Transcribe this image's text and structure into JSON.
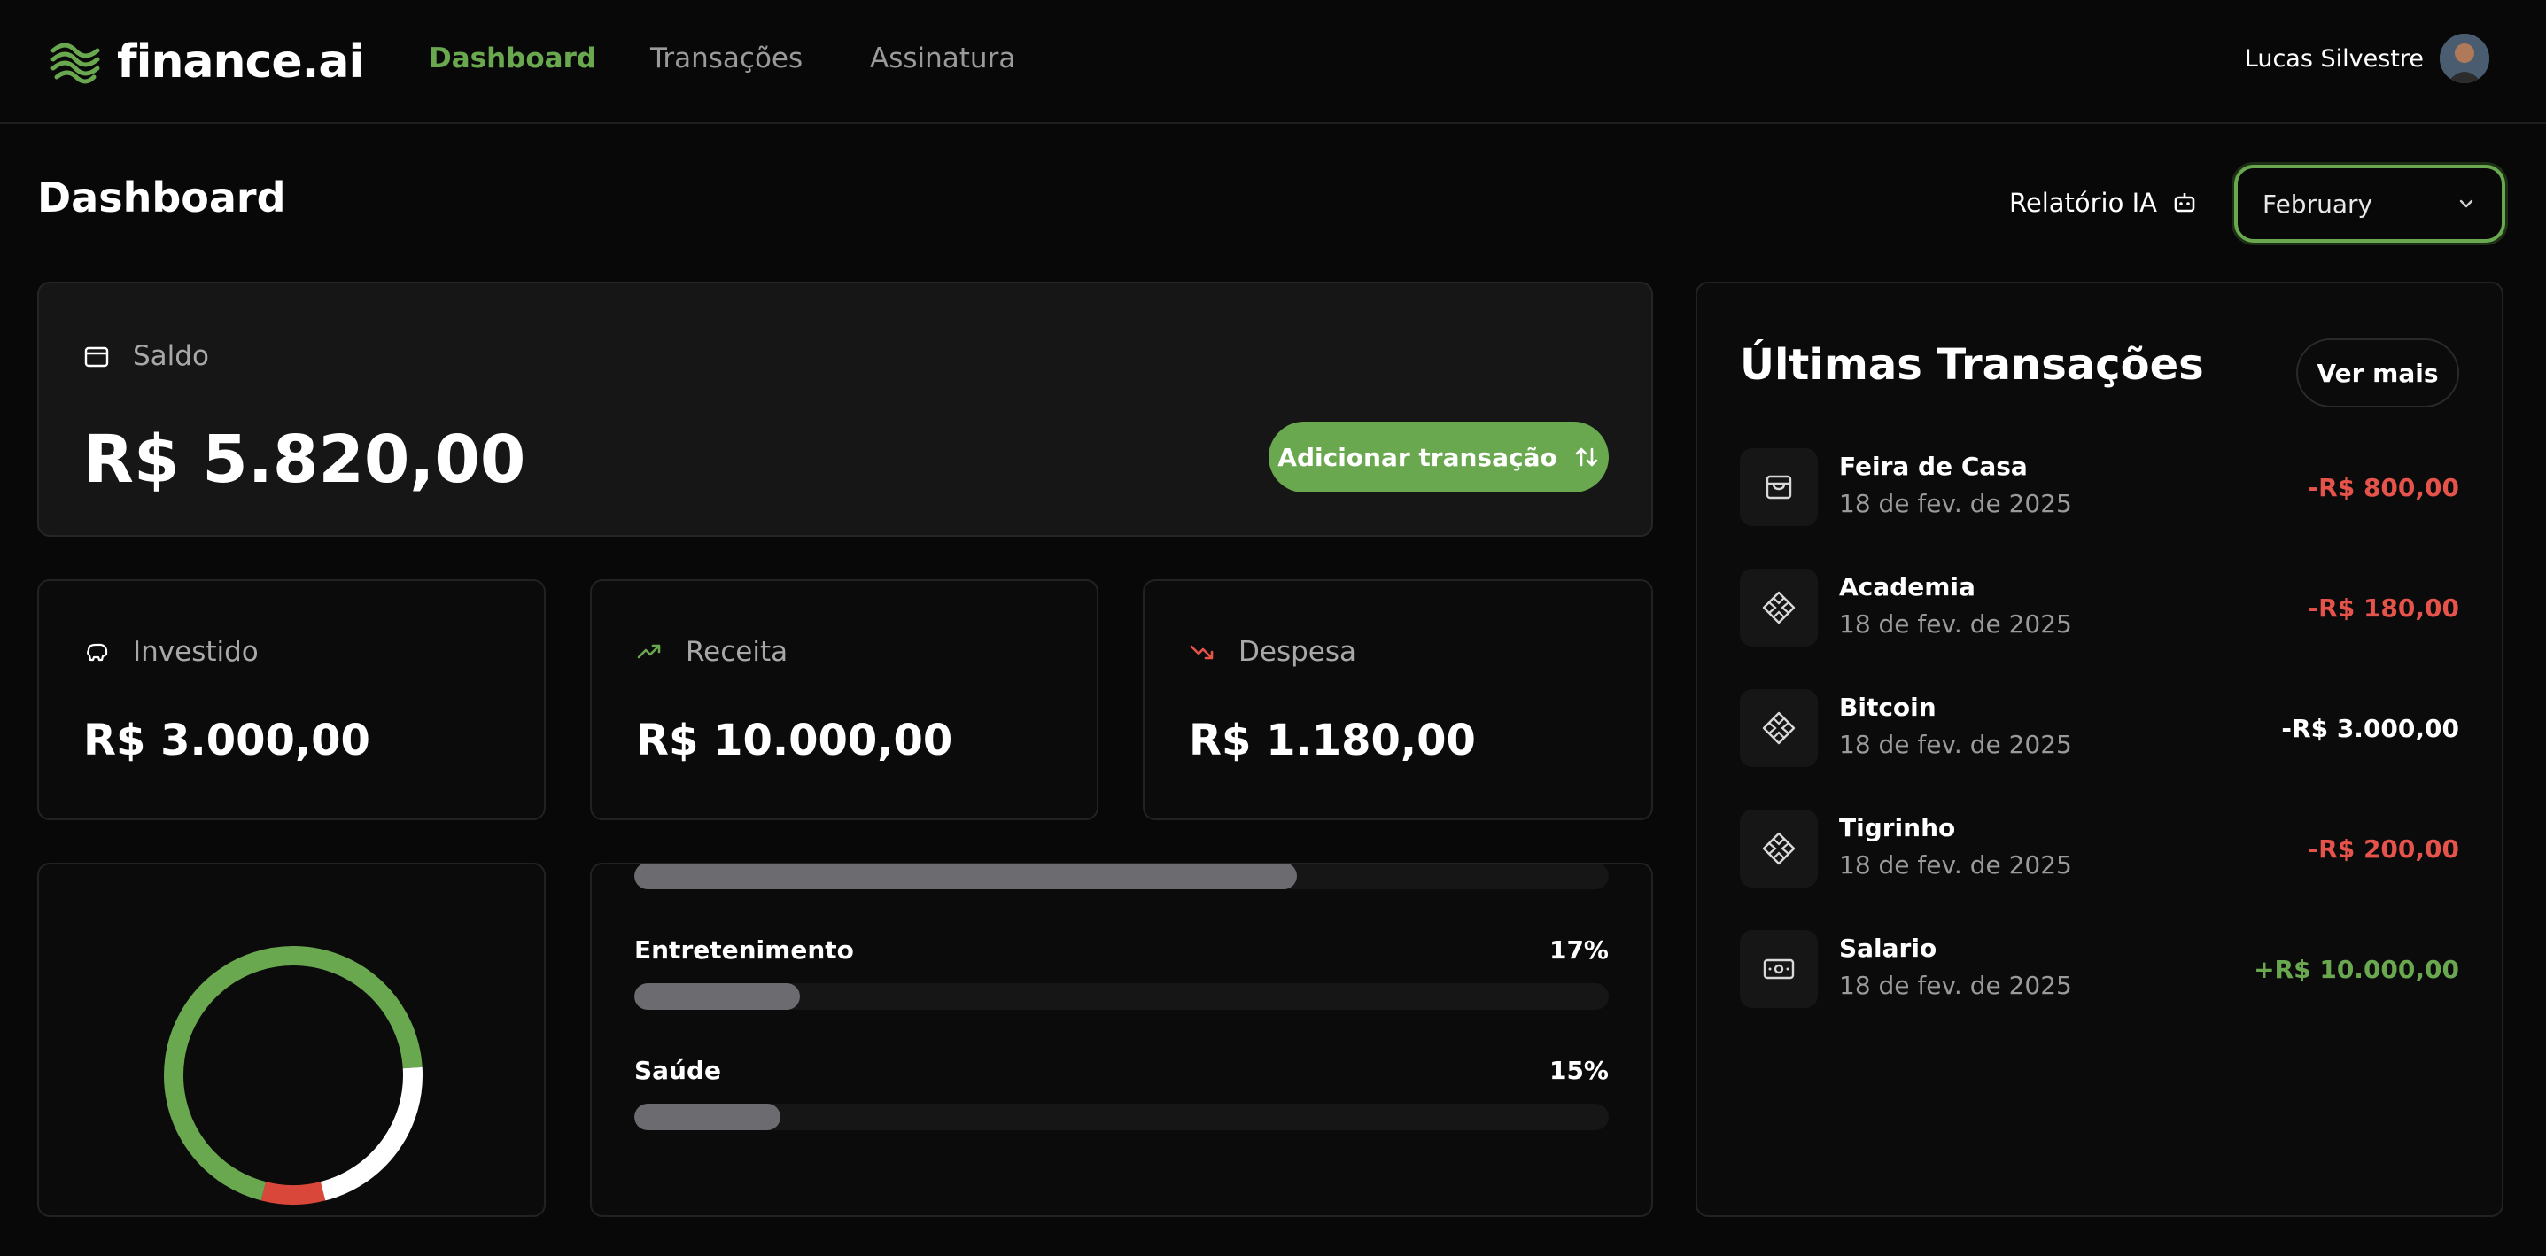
{
  "app": {
    "logo_text": "finance.ai",
    "nav": [
      {
        "label": "Dashboard",
        "active": true
      },
      {
        "label": "Transações",
        "active": false
      },
      {
        "label": "Assinatura",
        "active": false
      }
    ],
    "user_name": "Lucas Silvestre"
  },
  "header": {
    "title": "Dashboard",
    "report_label": "Relatório IA",
    "month_value": "February"
  },
  "summary": {
    "saldo_label": "Saldo",
    "saldo_value": "R$ 5.820,00",
    "add_button_label": "Adicionar transação",
    "investido_label": "Investido",
    "investido_value": "R$ 3.000,00",
    "receita_label": "Receita",
    "receita_value": "R$ 10.000,00",
    "despesa_label": "Despesa",
    "despesa_value": "R$ 1.180,00"
  },
  "chart_data": {
    "type": "pie",
    "donut": true,
    "segments": [
      {
        "value": 70,
        "color": "#6aa84f"
      },
      {
        "value": 22,
        "color": "#ffffff"
      },
      {
        "value": 8,
        "color": "#d9473a"
      }
    ]
  },
  "categories": [
    {
      "label": "",
      "percent": "",
      "fill": 0.68
    },
    {
      "label": "Entretenimento",
      "percent": "17%",
      "fill": 0.17
    },
    {
      "label": "Saúde",
      "percent": "15%",
      "fill": 0.15
    }
  ],
  "transactions": {
    "title": "Últimas Transações",
    "more_label": "Ver mais",
    "items": [
      {
        "name": "Feira de Casa",
        "date": "18 de fev. de 2025",
        "amount": "-R$ 800,00",
        "color": "#e5534b",
        "icon": "market-icon"
      },
      {
        "name": "Academia",
        "date": "18 de fev. de 2025",
        "amount": "-R$ 180,00",
        "color": "#e5534b",
        "icon": "pix-icon"
      },
      {
        "name": "Bitcoin",
        "date": "18 de fev. de 2025",
        "amount": "-R$ 3.000,00",
        "color": "#ffffff",
        "icon": "pix-icon"
      },
      {
        "name": "Tigrinho",
        "date": "18 de fev. de 2025",
        "amount": "-R$ 200,00",
        "color": "#e5534b",
        "icon": "pix-icon"
      },
      {
        "name": "Salario",
        "date": "18 de fev. de 2025",
        "amount": "+R$ 10.000,00",
        "color": "#6aa84f",
        "icon": "cash-icon"
      }
    ]
  },
  "colors": {
    "accent": "#6aa84f",
    "negative": "#e5534b",
    "background": "#080808"
  }
}
